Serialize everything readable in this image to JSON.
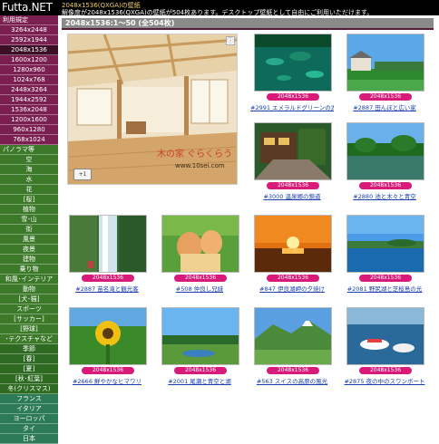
{
  "header": {
    "logo": "Futta.NET",
    "title": "2048x1536(QXGA)の壁紙",
    "desc": "解像度が2048x1536(QXGA)の壁紙が504枚あります。デスクトップ壁紙として自由にご利用いただけます。"
  },
  "sidebar": {
    "items": [
      {
        "label": "利用規定",
        "head": true,
        "group": "purple"
      },
      {
        "label": "3264x2448",
        "group": "purple"
      },
      {
        "label": "2592x1944",
        "group": "purple"
      },
      {
        "label": "2048x1536",
        "group": "purple",
        "active": true
      },
      {
        "label": "1600x1200",
        "group": "purple"
      },
      {
        "label": "1280x960",
        "group": "purple"
      },
      {
        "label": "1024x768",
        "group": "purple"
      },
      {
        "label": "2448x3264",
        "group": "purple"
      },
      {
        "label": "1944x2592",
        "group": "purple"
      },
      {
        "label": "1536x2048",
        "group": "purple"
      },
      {
        "label": "1200x1600",
        "group": "purple"
      },
      {
        "label": "960x1280",
        "group": "purple"
      },
      {
        "label": "768x1024",
        "group": "purple"
      },
      {
        "label": "パノラマ等",
        "head": true,
        "group": "green"
      },
      {
        "label": "空",
        "group": "green"
      },
      {
        "label": "海",
        "group": "green"
      },
      {
        "label": "水",
        "group": "green"
      },
      {
        "label": "花",
        "group": "green"
      },
      {
        "label": "[桜]",
        "group": "green"
      },
      {
        "label": "植物",
        "group": "green"
      },
      {
        "label": "雪･山",
        "group": "green"
      },
      {
        "label": "街",
        "group": "green"
      },
      {
        "label": "風景",
        "group": "green"
      },
      {
        "label": "夜景",
        "group": "green"
      },
      {
        "label": "建物",
        "group": "green"
      },
      {
        "label": "乗り物",
        "group": "green"
      },
      {
        "label": "和風･インテリア",
        "group": "green"
      },
      {
        "label": "動物",
        "group": "green"
      },
      {
        "label": "[犬･猫]",
        "group": "green"
      },
      {
        "label": "スポーツ",
        "group": "green"
      },
      {
        "label": "[サッカー]",
        "group": "green"
      },
      {
        "label": "[野球]",
        "group": "green"
      },
      {
        "label": "･テクスチャなど",
        "group": "green"
      },
      {
        "label": "季節",
        "group": "green2"
      },
      {
        "label": "[春]",
        "group": "green2"
      },
      {
        "label": "[夏]",
        "group": "green2"
      },
      {
        "label": "[秋･紅葉]",
        "group": "green2"
      },
      {
        "label": "冬(クリスマス)",
        "group": "green2"
      },
      {
        "label": "フランス",
        "group": "teal"
      },
      {
        "label": "イタリア",
        "group": "teal"
      },
      {
        "label": "ヨーロッパ",
        "group": "teal"
      },
      {
        "label": "タイ",
        "group": "teal"
      },
      {
        "label": "日本",
        "group": "teal"
      }
    ]
  },
  "main": {
    "page_label": "2048x1536:1～50 (全504枚)",
    "feature": {
      "caption": "木の家 ぐらくらう",
      "url": "www.10sei.com",
      "plus": "+1"
    },
    "badge": "2048x1536",
    "thumbs": [
      {
        "caption": "#2991 エメラルドグリーンの湖と湯"
      },
      {
        "caption": "#2887 田んぼと広い家"
      },
      {
        "caption": "#3000 温泉郷の鎖道"
      },
      {
        "caption": "#2880 池と木々と青空"
      },
      {
        "caption": "#2887 苗名滝と観光客"
      },
      {
        "caption": "#508 仲良し兄妹"
      },
      {
        "caption": "#847 伊良湖岬の夕焼け"
      },
      {
        "caption": "#2081 野尻湖と芝桜島の光"
      },
      {
        "caption": "#2666 鮮やかなヒマワリ"
      },
      {
        "caption": "#2001 尾瀬と青空と湖"
      },
      {
        "caption": "#563 スイスの高原の風光"
      },
      {
        "caption": "#2875 夜の中のスワンボート"
      }
    ]
  }
}
